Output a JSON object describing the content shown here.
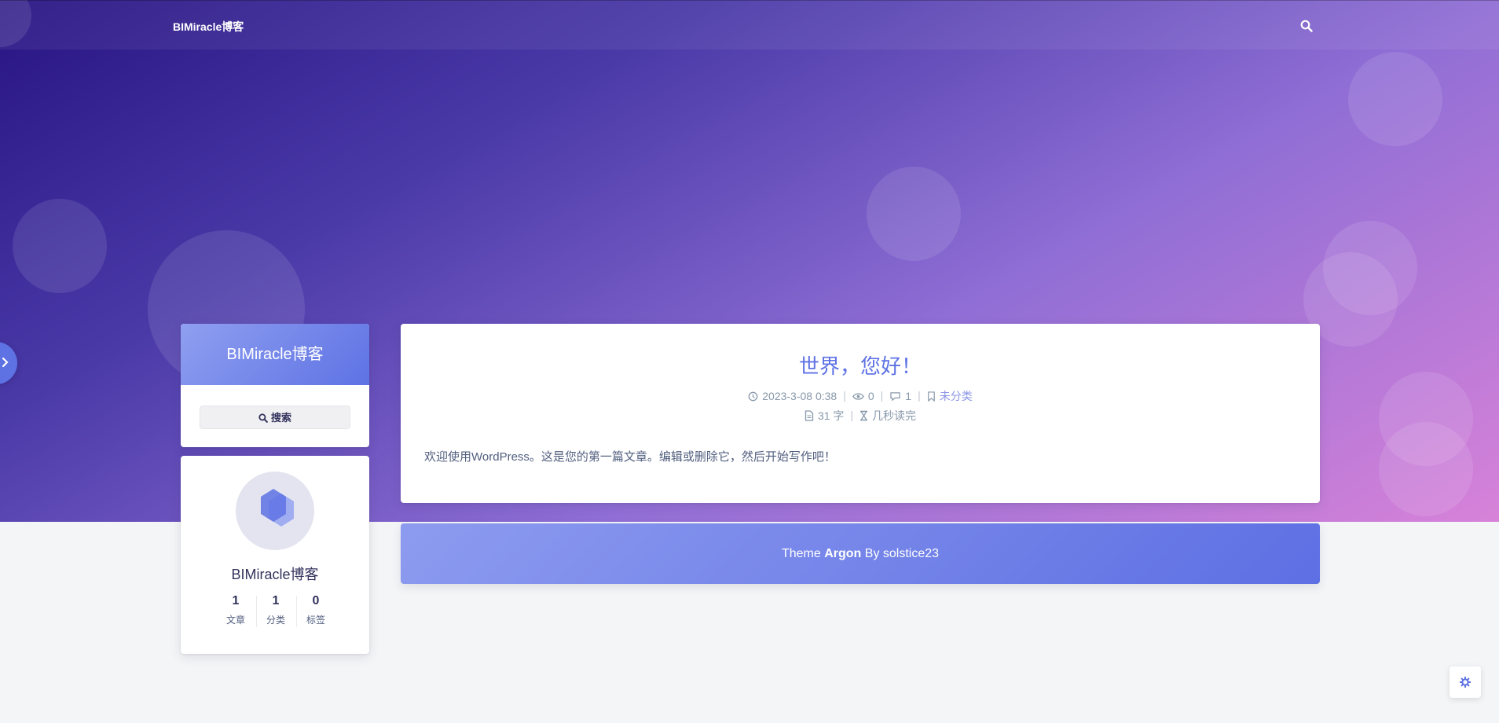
{
  "site": {
    "brand": "BIMiracle博客"
  },
  "sidebar": {
    "title": "BIMiracle博客",
    "search_label": "搜索",
    "author": {
      "name": "BIMiracle博客",
      "stats": [
        {
          "value": "1",
          "label": "文章"
        },
        {
          "value": "1",
          "label": "分类"
        },
        {
          "value": "0",
          "label": "标签"
        }
      ]
    }
  },
  "post": {
    "title": "世界，您好！",
    "date": "2023-3-08 0:38",
    "views": "0",
    "comments": "1",
    "category": "未分类",
    "words": "31 字",
    "read_time": "几秒读完",
    "excerpt": "欢迎使用WordPress。这是您的第一篇文章。编辑或删除它，然后开始写作吧！"
  },
  "footer": {
    "prefix": "Theme",
    "theme": "Argon",
    "suffix": "By solstice23"
  },
  "icons": [
    "search-icon",
    "chevron-right-icon",
    "clock-icon",
    "eye-icon",
    "comment-icon",
    "bookmark-icon",
    "file-icon",
    "hourglass-icon",
    "gear-icon"
  ],
  "colors": {
    "accent": "#5e72e4",
    "banner_start": "#281483",
    "banner_end": "#d782d9"
  }
}
